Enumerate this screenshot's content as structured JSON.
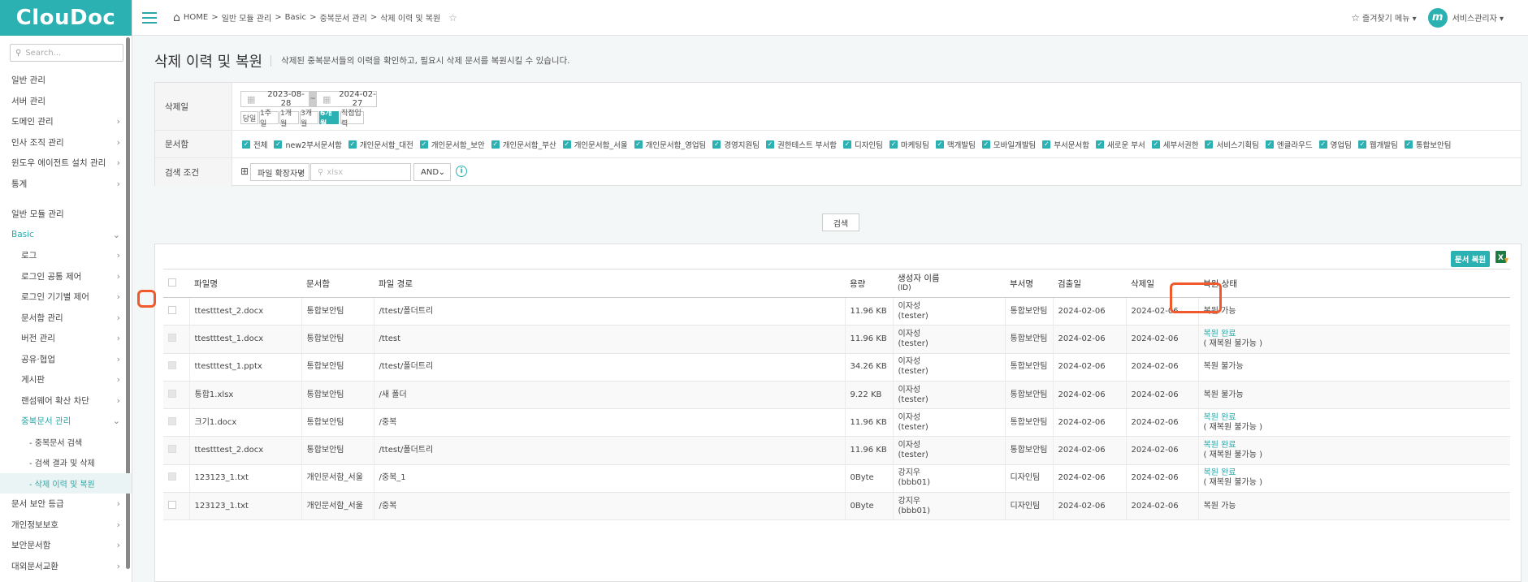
{
  "brand": {
    "logo": "ClouDoc",
    "accent": "#2bb1b1",
    "highlight": "#f0592b"
  },
  "sidebar": {
    "search_placeholder": "Search...",
    "items": [
      {
        "label": "일반 관리",
        "chev": ""
      },
      {
        "label": "서버 관리",
        "chev": ""
      },
      {
        "label": "도메인 관리",
        "chev": "›"
      },
      {
        "label": "인사 조직 관리",
        "chev": "›"
      },
      {
        "label": "윈도우 에이전트 설치 관리",
        "chev": "›"
      },
      {
        "label": "통계",
        "chev": "›"
      }
    ],
    "section": "일반 모듈 관리",
    "basic": {
      "label": "Basic",
      "chev": "⌄"
    },
    "basic_children": [
      {
        "label": "로그"
      },
      {
        "label": "로그인 공통 제어"
      },
      {
        "label": "로그인 기기별 제어"
      },
      {
        "label": "문서함 관리"
      },
      {
        "label": "버전 관리"
      },
      {
        "label": "공유·협업"
      },
      {
        "label": "게시판"
      },
      {
        "label": "랜섬웨어 확산 차단"
      }
    ],
    "dup": {
      "label": "중복문서 관리",
      "chev": "⌄"
    },
    "dup_children": [
      {
        "label": "- 중복문서 검색"
      },
      {
        "label": "- 검색 결과 및 삭제"
      },
      {
        "label": "- 삭제 이력 및 복원"
      }
    ],
    "tail": [
      {
        "label": "문서 보안 등급"
      },
      {
        "label": "개인정보보호"
      },
      {
        "label": "보안문서함"
      },
      {
        "label": "대외문서교환"
      }
    ]
  },
  "topbar": {
    "breadcrumb": [
      "HOME",
      "일반 모듈 관리",
      "Basic",
      "중복문서 관리",
      "삭제 이력 및 복원"
    ],
    "fav_menu": "즐겨찾기 메뉴 ▾",
    "avatar_letter": "m",
    "user": "서비스관리자 ▾"
  },
  "page": {
    "title": "삭제 이력 및 복원",
    "desc": "삭제된 중복문서들의 이력을 확인하고, 필요시 삭제 문서를 복원시킬 수 있습니다."
  },
  "filter": {
    "date_label": "삭제일",
    "date_from": "2023-08-28",
    "date_to": "2024-02-27",
    "date_dash": "~",
    "periods": [
      "당일",
      "1주일",
      "1개월",
      "3개월",
      "6개월",
      "직접입력"
    ],
    "active_period": "6개월",
    "docbox_label": "문서함",
    "docboxes": [
      "전체",
      "new2부서문서함",
      "개인문서함_대전",
      "개인문서함_보안",
      "개인문서함_부산",
      "개인문서함_서울",
      "개인문서함_영업팀",
      "경영지원팀",
      "권한테스트 부서함",
      "디자인팀",
      "마케팅팀",
      "맥개발팀",
      "모바일개발팀",
      "부서문서함",
      "새로운 부서",
      "세부서권한",
      "서비스기획팀",
      "엔클라우드",
      "영업팀",
      "웹개발팀",
      "통합보안팀"
    ],
    "cond_label": "검색 조건",
    "cond_plus": "⊞",
    "cond_field": "파일 확장자명",
    "cond_placeholder": "xlsx",
    "cond_op": "AND",
    "search_btn": "검색"
  },
  "results": {
    "restore_btn": "문서 복원",
    "columns": [
      "파일명",
      "문서함",
      "파일 경로",
      "용량",
      "생성자 이름",
      "(ID)",
      "부서명",
      "검출일",
      "삭제일",
      "복원 상태"
    ],
    "rows": [
      {
        "file": "ttestttest_2.docx",
        "box": "통합보안팀",
        "path": "/ttest/폴더트리",
        "size": "11.96 KB",
        "creator": "이자성",
        "id": "(tester)",
        "dept": "통합보안팀",
        "detected": "2024-02-06",
        "deleted": "2024-02-06",
        "status": "복원 가능",
        "status2": "",
        "disabled": false
      },
      {
        "file": "ttestttest_1.docx",
        "box": "통합보안팀",
        "path": "/ttest",
        "size": "11.96 KB",
        "creator": "이자성",
        "id": "(tester)",
        "dept": "통합보안팀",
        "detected": "2024-02-06",
        "deleted": "2024-02-06",
        "status": "복원 완료",
        "status2": "( 재복원 불가능 )",
        "disabled": true
      },
      {
        "file": "ttestttest_1.pptx",
        "box": "통합보안팀",
        "path": "/ttest/폴더트리",
        "size": "34.26 KB",
        "creator": "이자성",
        "id": "(tester)",
        "dept": "통합보안팀",
        "detected": "2024-02-06",
        "deleted": "2024-02-06",
        "status": "복원 불가능",
        "status2": "",
        "disabled": true
      },
      {
        "file": "통합1.xlsx",
        "box": "통합보안팀",
        "path": "/새 폴더",
        "size": "9.22 KB",
        "creator": "이자성",
        "id": "(tester)",
        "dept": "통합보안팀",
        "detected": "2024-02-06",
        "deleted": "2024-02-06",
        "status": "복원 불가능",
        "status2": "",
        "disabled": true
      },
      {
        "file": "크기1.docx",
        "box": "통합보안팀",
        "path": "/중복",
        "size": "11.96 KB",
        "creator": "이자성",
        "id": "(tester)",
        "dept": "통합보안팀",
        "detected": "2024-02-06",
        "deleted": "2024-02-06",
        "status": "복원 완료",
        "status2": "( 재복원 불가능 )",
        "disabled": true
      },
      {
        "file": "ttestttest_2.docx",
        "box": "통합보안팀",
        "path": "/ttest/폴더트리",
        "size": "11.96 KB",
        "creator": "이자성",
        "id": "(tester)",
        "dept": "통합보안팀",
        "detected": "2024-02-06",
        "deleted": "2024-02-06",
        "status": "복원 완료",
        "status2": "( 재복원 불가능 )",
        "disabled": true
      },
      {
        "file": "123123_1.txt",
        "box": "개인문서함_서울",
        "path": "/중복_1",
        "size": "0Byte",
        "creator": "강지우",
        "id": "(bbb01)",
        "dept": "디자인팀",
        "detected": "2024-02-06",
        "deleted": "2024-02-06",
        "status": "복원 완료",
        "status2": "( 재복원 불가능 )",
        "disabled": true
      },
      {
        "file": "123123_1.txt",
        "box": "개인문서함_서울",
        "path": "/중복",
        "size": "0Byte",
        "creator": "강지우",
        "id": "(bbb01)",
        "dept": "디자인팀",
        "detected": "2024-02-06",
        "deleted": "2024-02-06",
        "status": "복원 가능",
        "status2": "",
        "disabled": false
      }
    ]
  }
}
